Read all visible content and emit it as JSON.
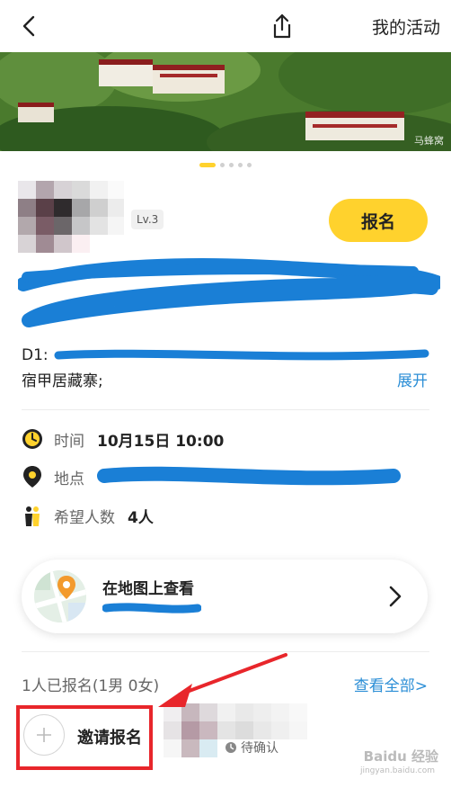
{
  "nav": {
    "my_activity": "我的活动"
  },
  "banner": {
    "watermark": "马蜂窝",
    "slide_count": 5,
    "active_slide": 1
  },
  "organizer": {
    "level": "Lv.3"
  },
  "actions": {
    "signup": "报名",
    "expand": "展开"
  },
  "description": {
    "prefix": "D1:",
    "line2": "宿甲居藏寨;"
  },
  "info": {
    "time_label": "时间",
    "time_value": "10月15日 10:00",
    "place_label": "地点",
    "people_label": "希望人数",
    "people_value": "4人"
  },
  "map": {
    "title": "在地图上查看"
  },
  "participants": {
    "summary": "1人已报名(1男 0女)",
    "view_all": "查看全部>",
    "invite": "邀请报名",
    "pending_status": "待确认"
  },
  "watermark": {
    "brand": "Baidu 经验",
    "url": "jingyan.baidu.com"
  },
  "colors": {
    "accent_yellow": "#ffd22d",
    "link_blue": "#2b8ed6",
    "annotation_red": "#e8262b",
    "scribble_blue": "#1a7fd6"
  }
}
